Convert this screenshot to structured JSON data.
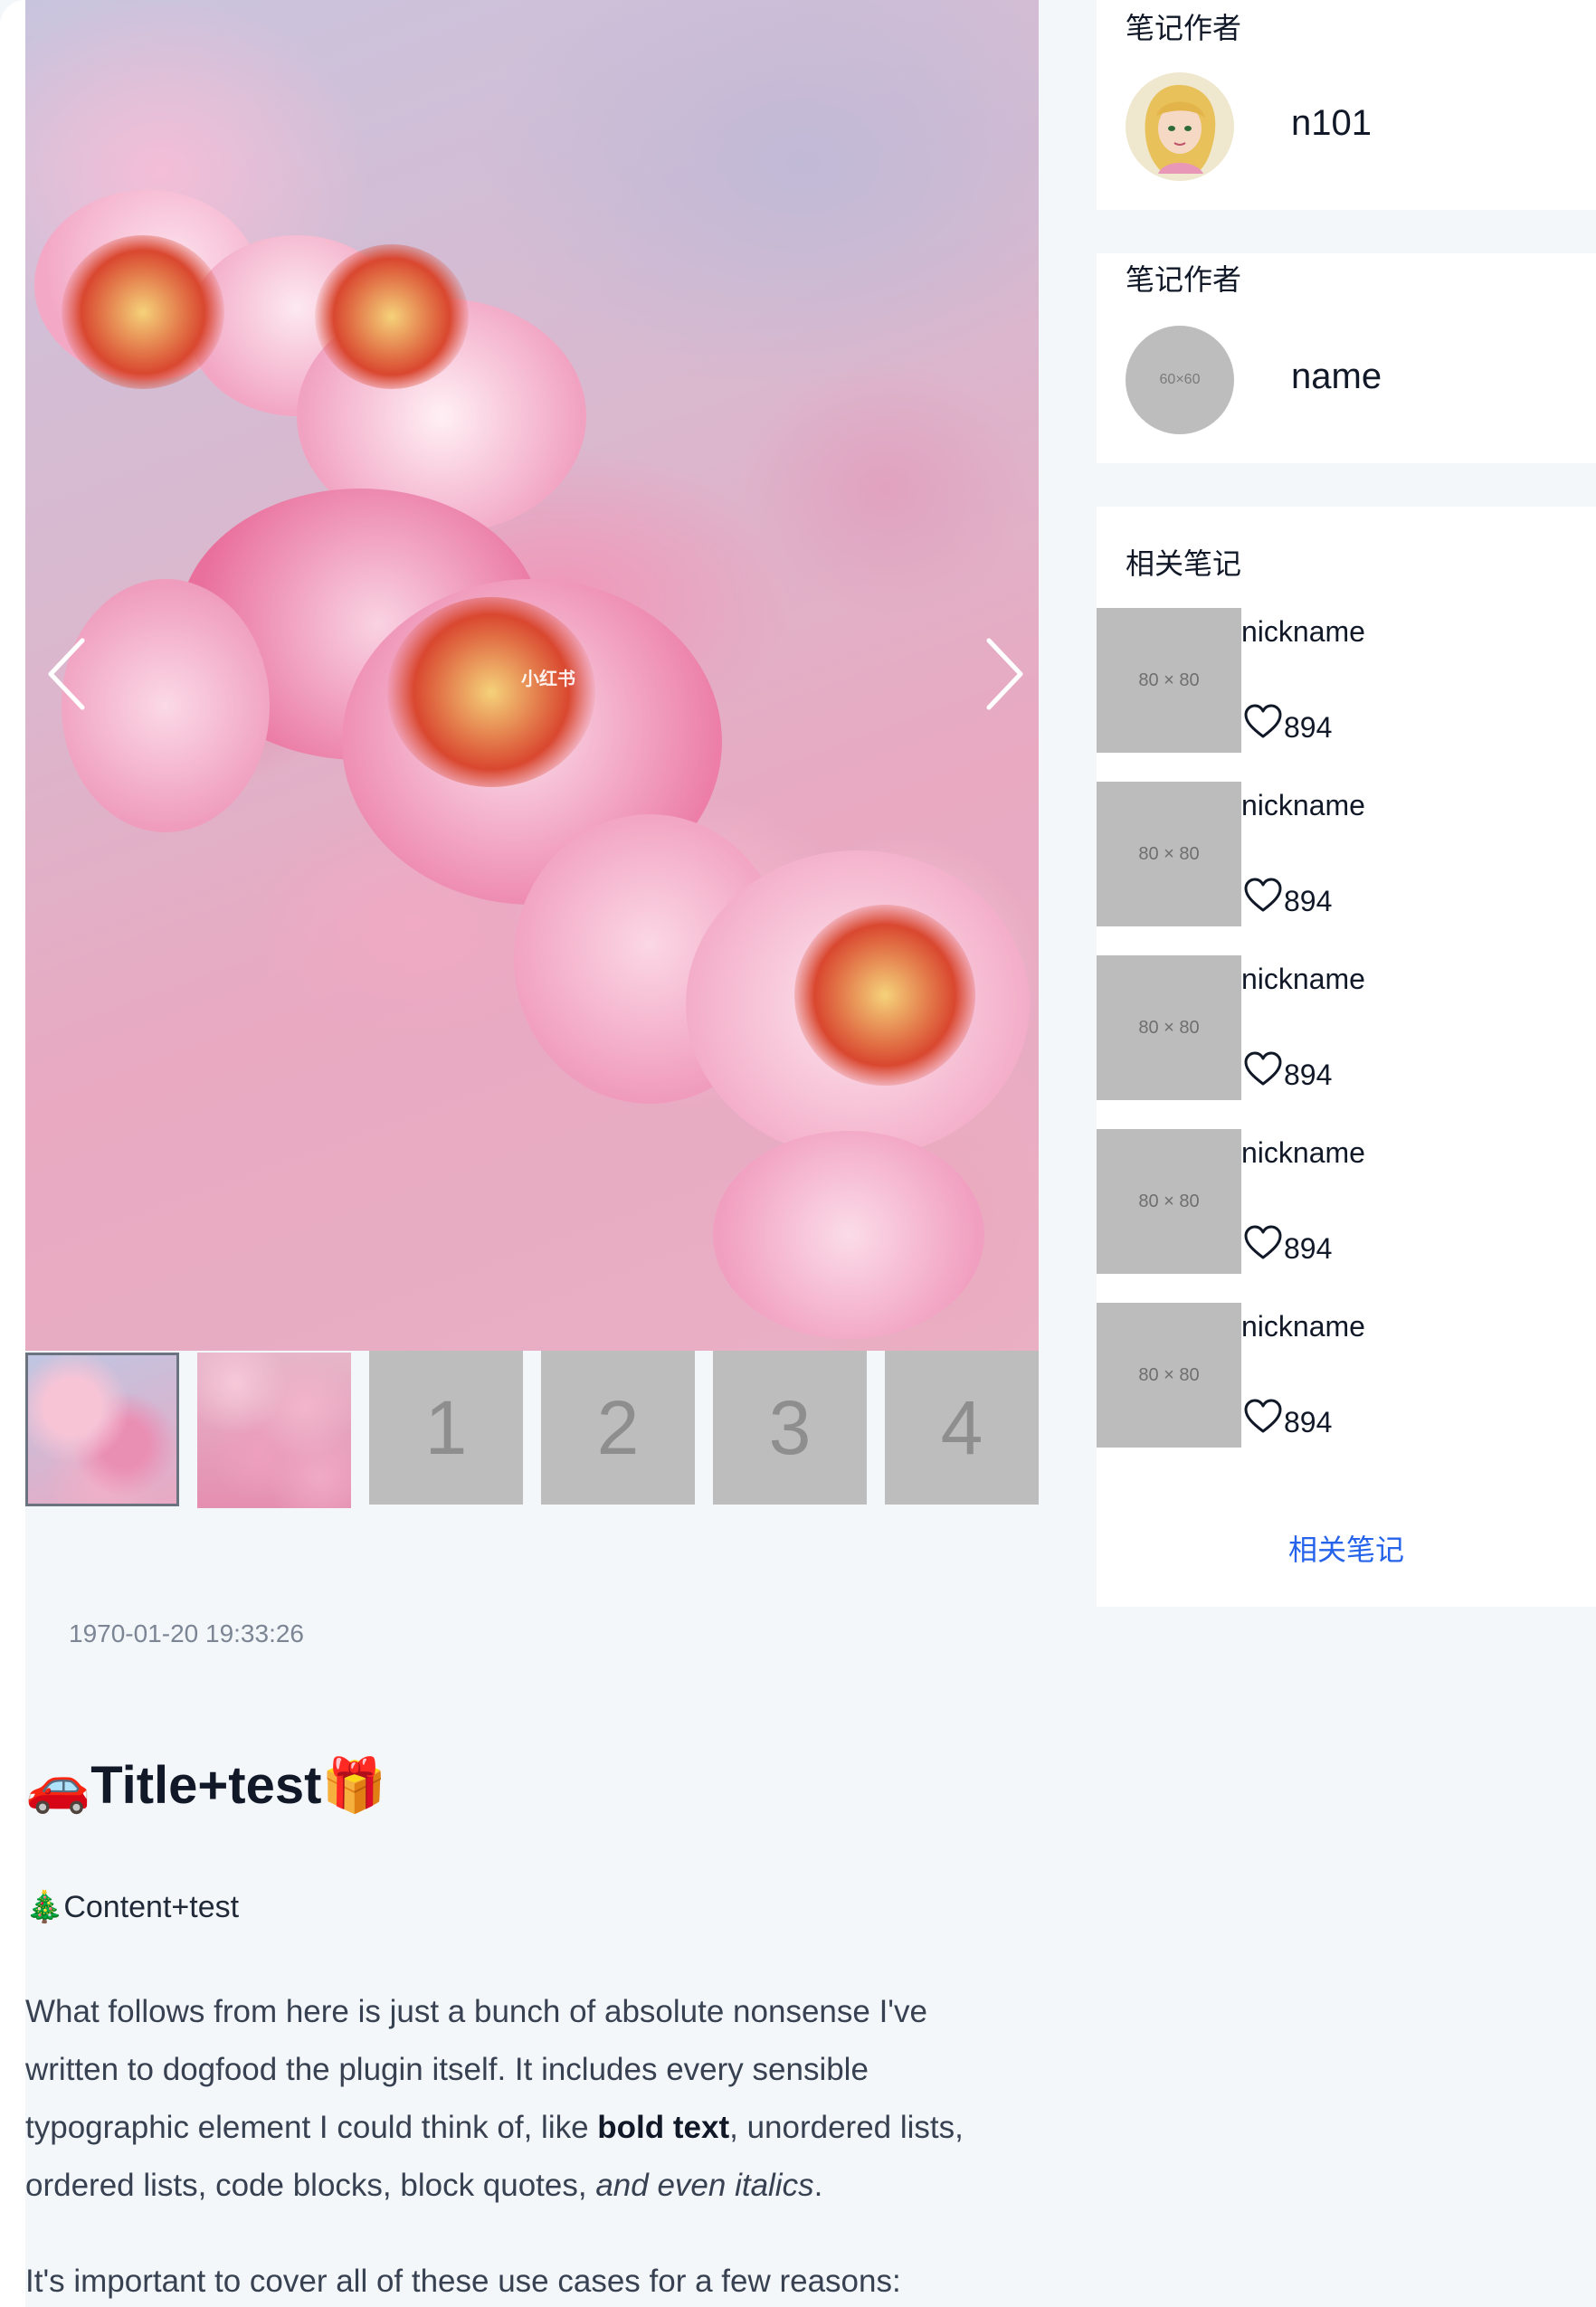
{
  "gallery": {
    "watermark": "小红书",
    "thumbnails": [
      {
        "type": "image",
        "selected": true
      },
      {
        "type": "image",
        "selected": false
      },
      {
        "type": "placeholder",
        "label": "1"
      },
      {
        "type": "placeholder",
        "label": "2"
      },
      {
        "type": "placeholder",
        "label": "3"
      },
      {
        "type": "placeholder",
        "label": "4"
      }
    ],
    "icons": {
      "prev": "chevron-left-icon",
      "next": "chevron-right-icon"
    }
  },
  "note": {
    "date": "1970-01-20 19:33:26",
    "title": "🚗Title+test🎁",
    "content_head": "🎄Content+test",
    "paragraph": {
      "part1": "What follows from here is just a bunch of absolute nonsense I've written to dogfood the plugin itself. It includes every sensible typographic element I could think of, like ",
      "bold": "bold text",
      "part2": ", unordered lists, ordered lists, code blocks, block quotes, ",
      "italic": "and even italics",
      "part3": "."
    },
    "paragraph2": "It's important to cover all of these use cases for a few reasons:"
  },
  "sidebar": {
    "author_card": {
      "title": "笔记作者",
      "name": "n101"
    },
    "author_card_placeholder": {
      "title": "笔记作者",
      "avatar_text": "60×60",
      "name": "name"
    },
    "related": {
      "title": "相关笔记",
      "items": [
        {
          "image_text": "80 × 80",
          "nickname": "nickname",
          "likes": "894"
        },
        {
          "image_text": "80 × 80",
          "nickname": "nickname",
          "likes": "894"
        },
        {
          "image_text": "80 × 80",
          "nickname": "nickname",
          "likes": "894"
        },
        {
          "image_text": "80 × 80",
          "nickname": "nickname",
          "likes": "894"
        },
        {
          "image_text": "80 × 80",
          "nickname": "nickname",
          "likes": "894"
        }
      ],
      "more_link": "相关笔记"
    }
  },
  "colors": {
    "background": "#f4f7fa",
    "link": "#2563eb",
    "placeholder": "#bdbdbd"
  }
}
